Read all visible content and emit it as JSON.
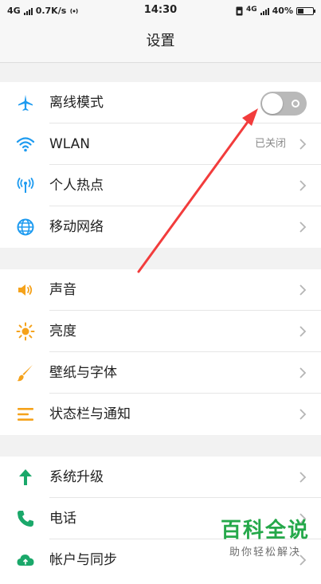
{
  "statusbar": {
    "network": "4G",
    "speed": "0.7K/s",
    "time": "14:30",
    "network_right": "4G",
    "battery_percent": "40%",
    "battery_level": 0.4
  },
  "header": {
    "title": "设置"
  },
  "groups": [
    {
      "items": [
        {
          "label": "离线模式",
          "icon": "airplane-icon",
          "control": "toggle",
          "toggle_on": false
        },
        {
          "label": "WLAN",
          "icon": "wifi-icon",
          "value": "已关闭"
        },
        {
          "label": "个人热点",
          "icon": "hotspot-icon"
        },
        {
          "label": "移动网络",
          "icon": "globe-icon"
        }
      ]
    },
    {
      "items": [
        {
          "label": "声音",
          "icon": "speaker-icon"
        },
        {
          "label": "亮度",
          "icon": "brightness-icon"
        },
        {
          "label": "壁纸与字体",
          "icon": "brush-icon"
        },
        {
          "label": "状态栏与通知",
          "icon": "list-icon"
        }
      ]
    },
    {
      "items": [
        {
          "label": "系统升级",
          "icon": "arrow-up-icon"
        },
        {
          "label": "电话",
          "icon": "phone-icon"
        },
        {
          "label": "帐户与同步",
          "icon": "cloud-icon"
        }
      ]
    }
  ],
  "colors": {
    "blue": "#1e9bf0",
    "orange": "#f5a21b",
    "green": "#1aa86a",
    "annotation_red": "#f23c3c",
    "watermark_green": "#25a84a"
  },
  "watermark": {
    "title": "百科全说",
    "subtitle": "助你轻松解决"
  }
}
